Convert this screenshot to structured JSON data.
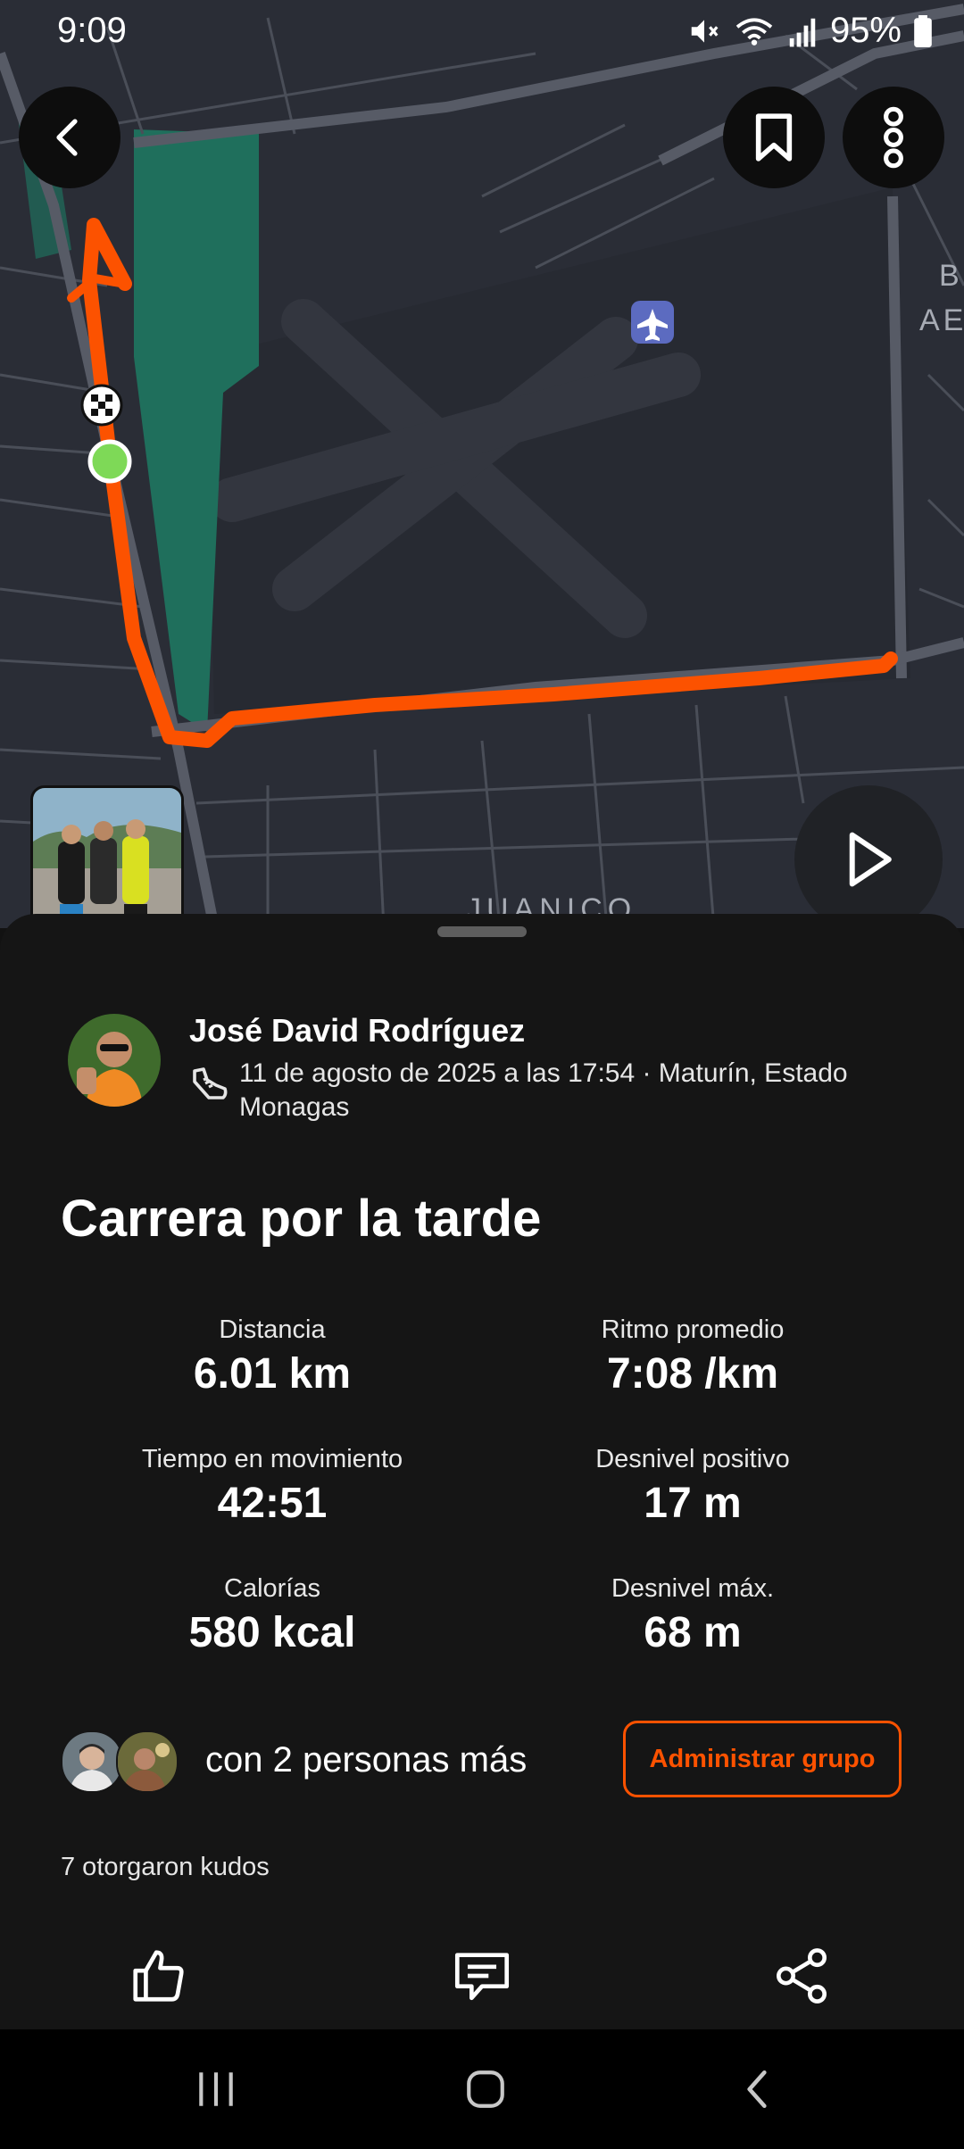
{
  "status_bar": {
    "time": "9:09",
    "battery": "95%",
    "icons": [
      "mute-icon",
      "wifi-icon",
      "signal-icon",
      "battery-icon"
    ]
  },
  "map": {
    "label_juanico": "JUANICO",
    "label_b": "B",
    "label_ae": "AE",
    "route_color": "#fc5200",
    "icons": [
      "airport-icon",
      "finish-flag-icon",
      "start-marker-icon"
    ]
  },
  "top_actions": [
    "back-icon",
    "bookmark-icon",
    "more-icon"
  ],
  "athlete": {
    "name": "José David Rodríguez",
    "date_location": "11 de agosto de 2025 a las 17:54 · Maturín, Estado Monagas"
  },
  "activity": {
    "title": "Carrera por la tarde"
  },
  "stats": {
    "distance": {
      "label": "Distancia",
      "value": "6.01 km"
    },
    "pace": {
      "label": "Ritmo promedio",
      "value": "7:08 /km"
    },
    "moving_time": {
      "label": "Tiempo en movimiento",
      "value": "42:51"
    },
    "elevation_gain": {
      "label": "Desnivel positivo",
      "value": "17 m"
    },
    "calories": {
      "label": "Calorías",
      "value": "580 kcal"
    },
    "max_elevation": {
      "label": "Desnivel máx.",
      "value": "68 m"
    }
  },
  "group": {
    "text": "con 2 personas más",
    "manage_label": "Administrar grupo"
  },
  "kudos": {
    "text": "7 otorgaron kudos"
  },
  "actions": [
    "kudos-icon",
    "comment-icon",
    "share-icon"
  ],
  "colors": {
    "accent": "#fc5200",
    "background": "#151515",
    "map_background": "#2a2d36",
    "park": "#1f6f5c"
  }
}
